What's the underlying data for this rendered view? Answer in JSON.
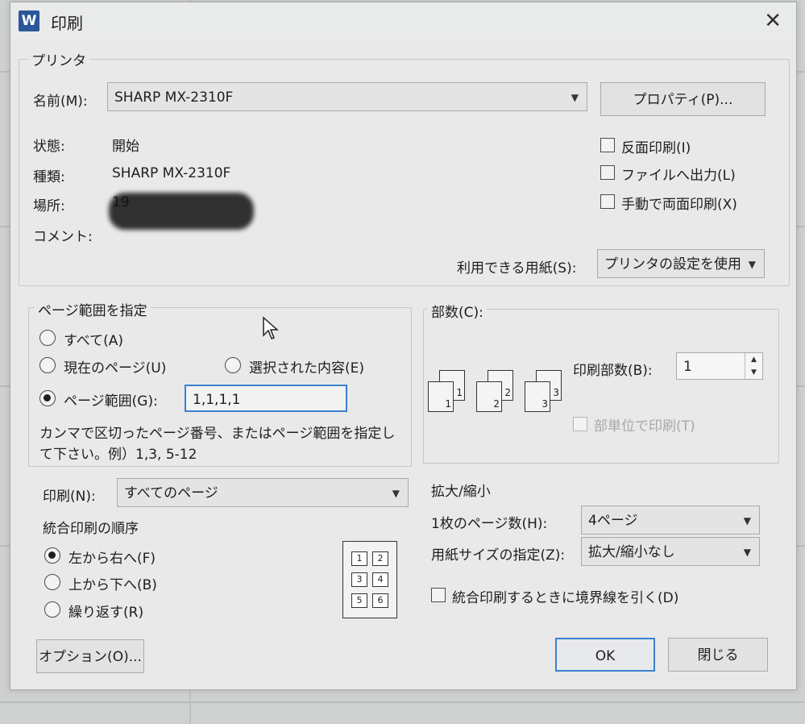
{
  "window": {
    "title": "印刷",
    "app_icon": "W"
  },
  "printer": {
    "group_label": "プリンタ",
    "name_label": "名前(M):",
    "name_value": "SHARP MX-2310F",
    "properties_button": "プロパティ(P)...",
    "status_label": "状態:",
    "status_value": "開始",
    "type_label": "種類:",
    "type_value": "SHARP MX-2310F",
    "location_label": "場所:",
    "location_value": "19",
    "comment_label": "コメント:",
    "reverse_print": "反面印刷(I)",
    "print_to_file": "ファイルへ出力(L)",
    "manual_duplex": "手動で両面印刷(X)",
    "paper_label": "利用できる用紙(S):",
    "paper_value": "プリンタの設定を使用"
  },
  "page_range": {
    "group_label": "ページ範囲を指定",
    "all": "すべて(A)",
    "current": "現在のページ(U)",
    "selection": "選択された内容(E)",
    "range": "ページ範囲(G):",
    "range_value": "1,1,1,1",
    "hint_line1": "カンマで区切ったページ番号、またはページ範囲を指定し",
    "hint_line2": "て下さい。例）1,3, 5-12"
  },
  "print_what": {
    "label": "印刷(N):",
    "value": "すべてのページ"
  },
  "collate_order": {
    "label": "統合印刷の順序",
    "left_to_right": "左から右へ(F)",
    "top_to_bottom": "上から下へ(B)",
    "repeat": "繰り返す(R)",
    "grid_numbers": [
      "1",
      "2",
      "3",
      "4",
      "5",
      "6"
    ]
  },
  "copies": {
    "group_label": "部数(C):",
    "count_label": "印刷部数(B):",
    "count_value": "1",
    "collate": "部単位で印刷(T)",
    "page_numbers": [
      "1",
      "1",
      "2",
      "2",
      "3",
      "3"
    ]
  },
  "zoom": {
    "label": "拡大/縮小",
    "pages_per_sheet_label": "1枚のページ数(H):",
    "pages_per_sheet_value": "4ページ",
    "scale_label": "用紙サイズの指定(Z):",
    "scale_value": "拡大/縮小なし",
    "draw_borders": "統合印刷するときに境界線を引く(D)"
  },
  "buttons": {
    "options": "オプション(O)...",
    "ok": "OK",
    "close": "閉じる"
  },
  "colors": {
    "accent": "#3b7fd0",
    "app_icon_bg": "#2b579a"
  }
}
